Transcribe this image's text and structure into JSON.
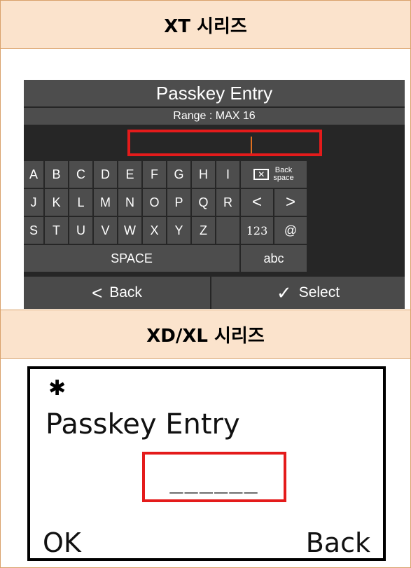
{
  "sections": {
    "xt_header": "XT 시리즈",
    "xd_header": "XD/XL 시리즈"
  },
  "xt": {
    "title": "Passkey Entry",
    "range": "Range : MAX 16",
    "rows": [
      [
        "A",
        "B",
        "C",
        "D",
        "E",
        "F",
        "G",
        "H",
        "I"
      ],
      [
        "J",
        "K",
        "L",
        "M",
        "N",
        "O",
        "P",
        "Q",
        "R"
      ],
      [
        "S",
        "T",
        "U",
        "V",
        "W",
        "X",
        "Y",
        "Z",
        ""
      ]
    ],
    "backspace_label_1": "Back",
    "backspace_label_2": "space",
    "left_arrow": "<",
    "right_arrow": ">",
    "numbers_key": "123",
    "at_key": "@",
    "space_key": "SPACE",
    "abc_key": "abc",
    "back_button": "Back",
    "select_button": "Select",
    "back_glyph": "<",
    "select_glyph": "✓"
  },
  "xd": {
    "bluetooth_glyph": "✱",
    "title": "Passkey Entry",
    "input_value": "______",
    "ok": "OK",
    "back": "Back"
  },
  "colors": {
    "header_bg": "#fbe3cc",
    "border": "#d9a16a",
    "highlight_red": "#e41b1b",
    "cursor_orange": "#e07020"
  }
}
